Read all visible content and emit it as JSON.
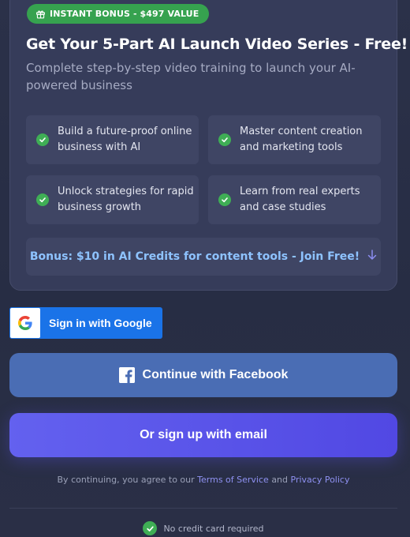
{
  "promo": {
    "badge_label": "INSTANT BONUS - $497 VALUE",
    "title": "Get Your 5-Part AI Launch Video Series - Free!",
    "subtitle": "Complete step-by-step video training to launch your AI-powered business",
    "features": [
      {
        "text": "Build a future-proof online business with AI"
      },
      {
        "text": "Master content creation and marketing tools"
      },
      {
        "text": "Unlock strategies for rapid business growth"
      },
      {
        "text": "Learn from real experts and case studies"
      }
    ],
    "bonus_text": "Bonus: $10 in AI Credits for content tools - Join Free!",
    "bonus_arrow_icon": "arrow-down-icon"
  },
  "auth": {
    "google_label": "Sign in with Google",
    "facebook_label": "Continue with Facebook",
    "email_label": "Or sign up with email",
    "consent_prefix": "By continuing, you agree to our",
    "terms_link": "Terms of Service",
    "consent_and": "and",
    "privacy_link": "Privacy Policy",
    "no_card": "No credit card required"
  },
  "colors": {
    "badge_green": "#36a24f",
    "check_green": "#3fae55",
    "google_blue": "#1a73e8",
    "facebook_blue": "#4a6db4",
    "email_purple": "#5b55ea",
    "link_purple": "#8f91f2",
    "bonus_blue": "#8ec3ff"
  }
}
